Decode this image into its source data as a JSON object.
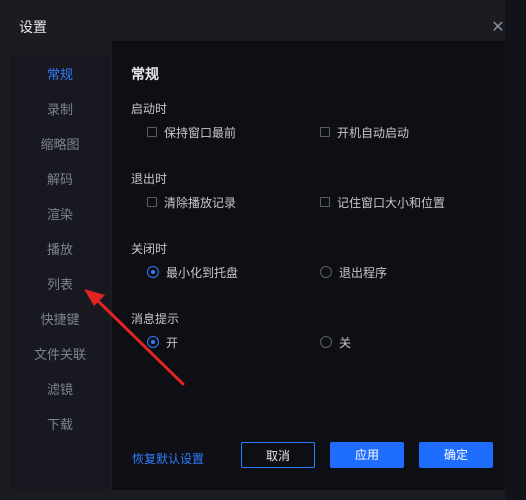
{
  "dialog": {
    "title": "设置",
    "close_symbol": "✕"
  },
  "sidebar": {
    "items": [
      {
        "label": "常规",
        "active": true
      },
      {
        "label": "录制",
        "active": false
      },
      {
        "label": "缩略图",
        "active": false
      },
      {
        "label": "解码",
        "active": false
      },
      {
        "label": "渲染",
        "active": false
      },
      {
        "label": "播放",
        "active": false
      },
      {
        "label": "列表",
        "active": false
      },
      {
        "label": "快捷键",
        "active": false
      },
      {
        "label": "文件关联",
        "active": false
      },
      {
        "label": "滤镜",
        "active": false
      },
      {
        "label": "下载",
        "active": false
      }
    ]
  },
  "content": {
    "heading": "常规",
    "sections": {
      "startup": {
        "label": "启动时",
        "options": [
          {
            "label": "保持窗口最前",
            "checked": false
          },
          {
            "label": "开机自动启动",
            "checked": false
          }
        ]
      },
      "exit": {
        "label": "退出时",
        "options": [
          {
            "label": "清除播放记录",
            "checked": false
          },
          {
            "label": "记住窗口大小和位置",
            "checked": false
          }
        ]
      },
      "close": {
        "label": "关闭时",
        "options": [
          {
            "label": "最小化到托盘",
            "selected": true
          },
          {
            "label": "退出程序",
            "selected": false
          }
        ]
      },
      "notify": {
        "label": "消息提示",
        "options": [
          {
            "label": "开",
            "selected": true
          },
          {
            "label": "关",
            "selected": false
          }
        ]
      }
    }
  },
  "footer": {
    "restore_defaults": "恢复默认设置",
    "cancel": "取消",
    "apply": "应用",
    "ok": "确定"
  },
  "colors": {
    "accent": "#1f6dff",
    "annotation_arrow": "#e02424"
  },
  "icons": {
    "close": "close-icon",
    "arrow": "annotation-arrow-icon"
  }
}
